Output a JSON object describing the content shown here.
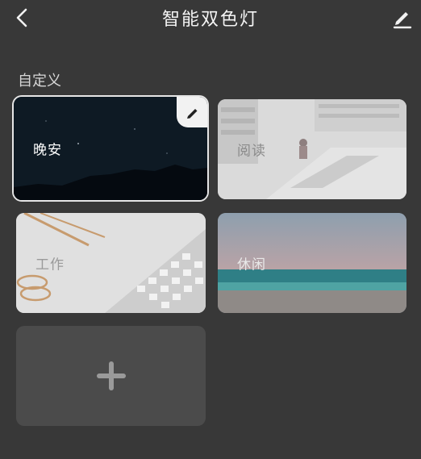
{
  "header": {
    "title": "智能双色灯",
    "back_icon": "chevron-left-icon",
    "edit_icon": "pencil-icon"
  },
  "section": {
    "label": "自定义"
  },
  "scenes": [
    {
      "label": "晚安",
      "selected": true
    },
    {
      "label": "阅读",
      "selected": false
    },
    {
      "label": "工作",
      "selected": false
    },
    {
      "label": "休闲",
      "selected": false
    }
  ],
  "add_card": {
    "icon": "plus-icon"
  },
  "colors": {
    "background": "#383838",
    "card_empty": "#4b4b4b",
    "selected_border": "#e6e6e6"
  }
}
